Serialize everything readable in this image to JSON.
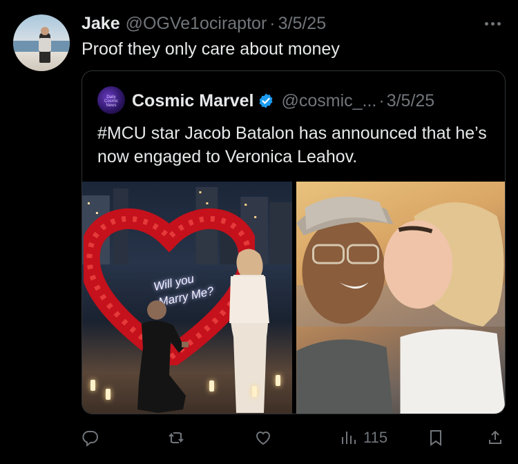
{
  "tweet": {
    "author_name": "Jake",
    "author_handle": "@OGVe1ociraptor",
    "separator": "·",
    "date": "3/5/25",
    "text": "Proof they only care about money"
  },
  "quoted_tweet": {
    "author_name": "Cosmic Marvel",
    "author_handle": "@cosmic_...",
    "separator": "·",
    "date": "3/5/25",
    "text": "#MCU star Jacob Batalon has announced that he’s now engaged to Veronica Leahov.",
    "avatar_text": "Daily Cosmic News",
    "media": [
      {
        "sign_line1": "Will you",
        "sign_line2": "Marry Me?"
      },
      {}
    ]
  },
  "actions": {
    "reply_icon": "reply-icon",
    "retweet_icon": "retweet-icon",
    "like_icon": "heart-icon",
    "views_icon": "views-icon",
    "views_count": "115",
    "bookmark_icon": "bookmark-icon",
    "share_icon": "share-icon"
  },
  "colors": {
    "background": "#000000",
    "text_primary": "#e7e9ea",
    "text_secondary": "#71767b",
    "verified": "#1d9bf0",
    "border": "#2f3336"
  }
}
